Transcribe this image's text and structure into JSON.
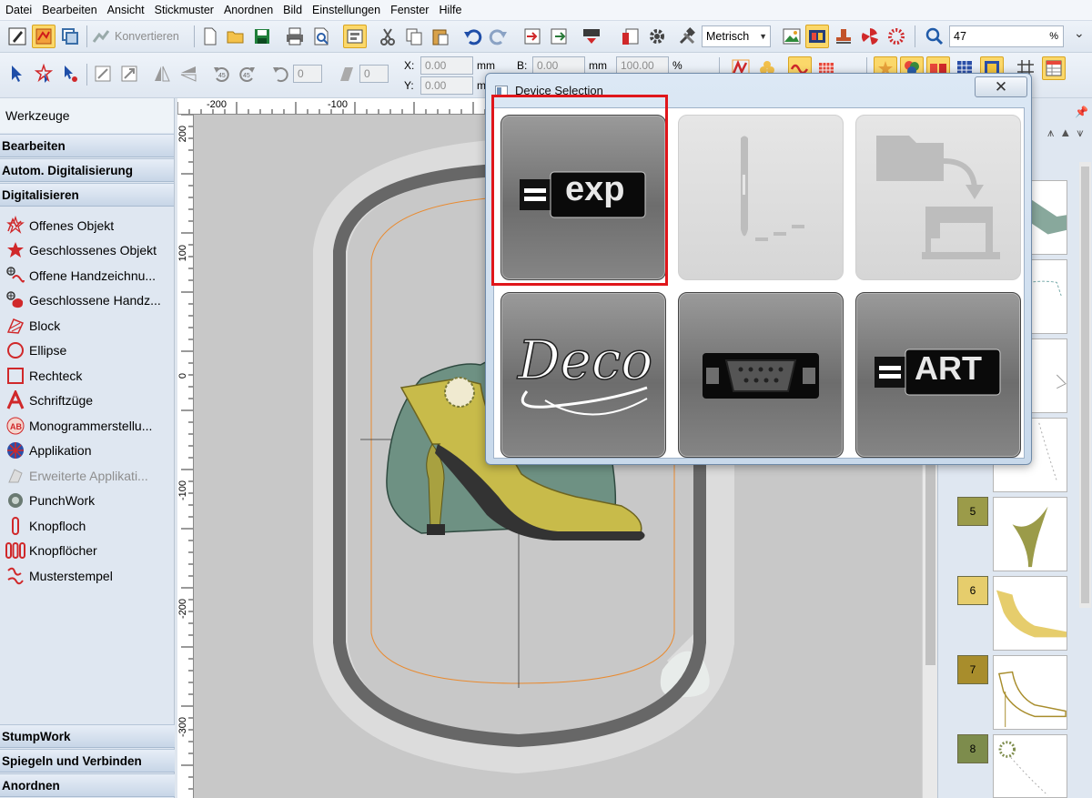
{
  "menu": [
    "Datei",
    "Bearbeiten",
    "Ansicht",
    "Stickmuster",
    "Anordnen",
    "Bild",
    "Einstellungen",
    "Fenster",
    "Hilfe"
  ],
  "toolbar1": {
    "convert_label": "Konvertieren",
    "units": "Metrisch",
    "zoom_value": "47",
    "zoom_unit": "%"
  },
  "toolbar2": {
    "rotate_value": "0",
    "slant_value": "0",
    "x_label": "X:",
    "x_value": "0.00",
    "y_label": "Y:",
    "y_value": "0.00",
    "w_label": "B:",
    "w_value": "0.00",
    "w_pct": "100.00",
    "unit_mm": "mm",
    "pct": "%"
  },
  "left_panel": {
    "title": "Werkzeuge",
    "sections_top": [
      "Bearbeiten",
      "Autom. Digitalisierung",
      "Digitalisieren"
    ],
    "tools": [
      {
        "label": "Offenes Objekt",
        "icon": "open-object-icon",
        "enabled": true
      },
      {
        "label": "Geschlossenes Objekt",
        "icon": "closed-object-icon",
        "enabled": true
      },
      {
        "label": "Offene Handzeichnu...",
        "icon": "open-freehand-icon",
        "enabled": true
      },
      {
        "label": "Geschlossene Handz...",
        "icon": "closed-freehand-icon",
        "enabled": true
      },
      {
        "label": "Block",
        "icon": "block-icon",
        "enabled": true
      },
      {
        "label": "Ellipse",
        "icon": "ellipse-icon",
        "enabled": true
      },
      {
        "label": "Rechteck",
        "icon": "rectangle-icon",
        "enabled": true
      },
      {
        "label": "Schriftzüge",
        "icon": "lettering-icon",
        "enabled": true
      },
      {
        "label": "Monogrammerstellu...",
        "icon": "monogram-icon",
        "enabled": true
      },
      {
        "label": "Applikation",
        "icon": "applique-icon",
        "enabled": true
      },
      {
        "label": "Erweiterte Applikati...",
        "icon": "advanced-applique-icon",
        "enabled": false
      },
      {
        "label": "PunchWork",
        "icon": "punchwork-icon",
        "enabled": true
      },
      {
        "label": "Knopfloch",
        "icon": "buttonhole-icon",
        "enabled": true
      },
      {
        "label": "Knopflöcher",
        "icon": "buttonholes-icon",
        "enabled": true
      },
      {
        "label": "Musterstempel",
        "icon": "pattern-stamp-icon",
        "enabled": true
      }
    ],
    "sections_bottom": [
      "StumpWork",
      "Spiegeln und Verbinden",
      "Anordnen"
    ]
  },
  "rulers": {
    "top_labels": [
      "-200",
      "-100"
    ],
    "left_labels": [
      "200",
      "100",
      "0",
      "-100",
      "-200",
      "-300"
    ]
  },
  "color_sequence": [
    {
      "number": "5",
      "color": "#9b9b49"
    },
    {
      "number": "6",
      "color": "#e6cd6c"
    },
    {
      "number": "7",
      "color": "#a88d2c"
    },
    {
      "number": "8",
      "color": "#7d8c4c"
    }
  ],
  "dialog": {
    "title": "Device Selection",
    "close_glyph": "✕",
    "tiles": [
      {
        "id": "exp",
        "text": "exp",
        "enabled": true,
        "selected": true
      },
      {
        "id": "machine-needle",
        "text": "",
        "enabled": false,
        "selected": false
      },
      {
        "id": "folder-machine",
        "text": "",
        "enabled": false,
        "selected": false
      },
      {
        "id": "deco",
        "text": "Deco",
        "enabled": true,
        "selected": false
      },
      {
        "id": "serial-port",
        "text": "",
        "enabled": true,
        "selected": false
      },
      {
        "id": "art",
        "text": "ART",
        "enabled": true,
        "selected": false
      }
    ]
  },
  "colors": {
    "selection_highlight": "#e0161b",
    "toolbar_active": "#fbd86a",
    "hoop_dark": "#676767",
    "guide_orange": "#e98a2f",
    "shoe_yellow": "#c8bb4a",
    "fabric_green": "#6e9183"
  }
}
